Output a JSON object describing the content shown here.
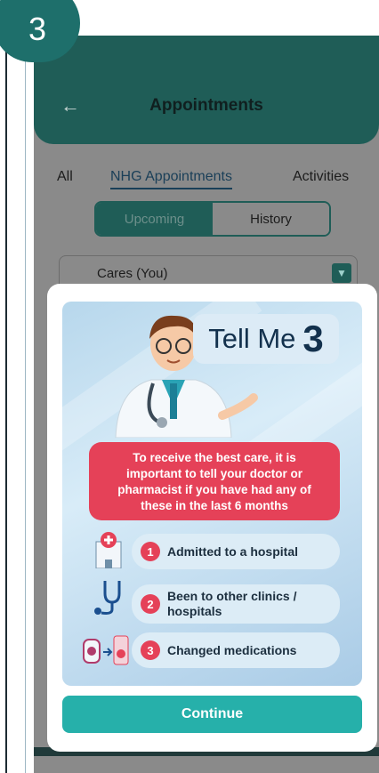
{
  "step": {
    "number": "3"
  },
  "header": {
    "back_icon": "back-arrow-icon",
    "title": "Appointments"
  },
  "tabs": [
    {
      "label": "All"
    },
    {
      "label": "NHG Appointments"
    },
    {
      "label": "Activities"
    }
  ],
  "segment": {
    "upcoming": "Upcoming",
    "history": "History"
  },
  "patient_select": {
    "value": "Cares (You)",
    "icon": "chevron-down-icon"
  },
  "modal": {
    "tell_me": "Tell Me",
    "tell_me_number": "3",
    "intro_lines": [
      "To receive the best care, it is",
      "important to tell your doctor or",
      "pharmacist if you have had any of",
      "these in the last 6 months"
    ],
    "items": [
      {
        "number": "1",
        "text": "Admitted to a hospital",
        "icon": "hospital-icon"
      },
      {
        "number": "2",
        "text": "Been to other clinics / hospitals",
        "icon": "stethoscope-icon"
      },
      {
        "number": "3",
        "text": "Changed medications",
        "icon": "medication-icon"
      }
    ],
    "continue_label": "Continue"
  },
  "colors": {
    "brand_teal": "#1f5d57",
    "button_teal": "#26b0aa",
    "alert_red": "#e54158",
    "badge_green": "#1e6f6b"
  }
}
